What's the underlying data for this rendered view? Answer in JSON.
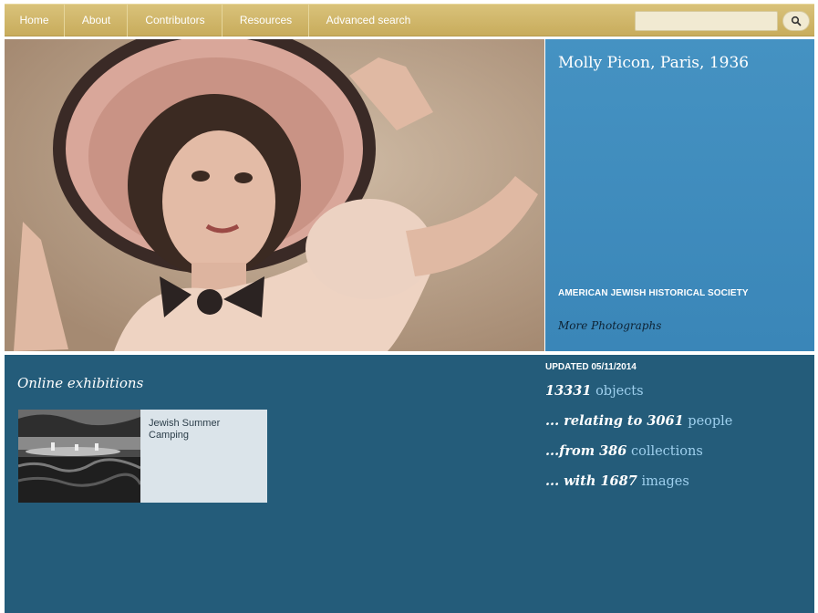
{
  "nav": {
    "items": [
      "Home",
      "About",
      "Contributors",
      "Resources",
      "Advanced search"
    ],
    "search_placeholder": ""
  },
  "hero": {
    "title": "Molly Picon, Paris, 1936",
    "credit": "AMERICAN JEWISH HISTORICAL SOCIETY",
    "more_link": "More Photographs"
  },
  "exhibitions": {
    "heading": "Online exhibitions",
    "items": [
      {
        "label": "Jewish Summer Camping"
      }
    ]
  },
  "stats": {
    "updated": "UPDATED 05/11/2014",
    "lines": [
      {
        "prefix": "13331",
        "link": "objects"
      },
      {
        "prefix": "... relating to 3061",
        "link": "people"
      },
      {
        "prefix": "...from 386",
        "link": "collections"
      },
      {
        "prefix": "... with 1687",
        "link": "images"
      }
    ]
  },
  "colors": {
    "nav_gold": "#d2b96b",
    "hero_panel_blue": "#4190c0",
    "lower_teal": "#245c7a",
    "link_blue": "#9fd0ee"
  }
}
